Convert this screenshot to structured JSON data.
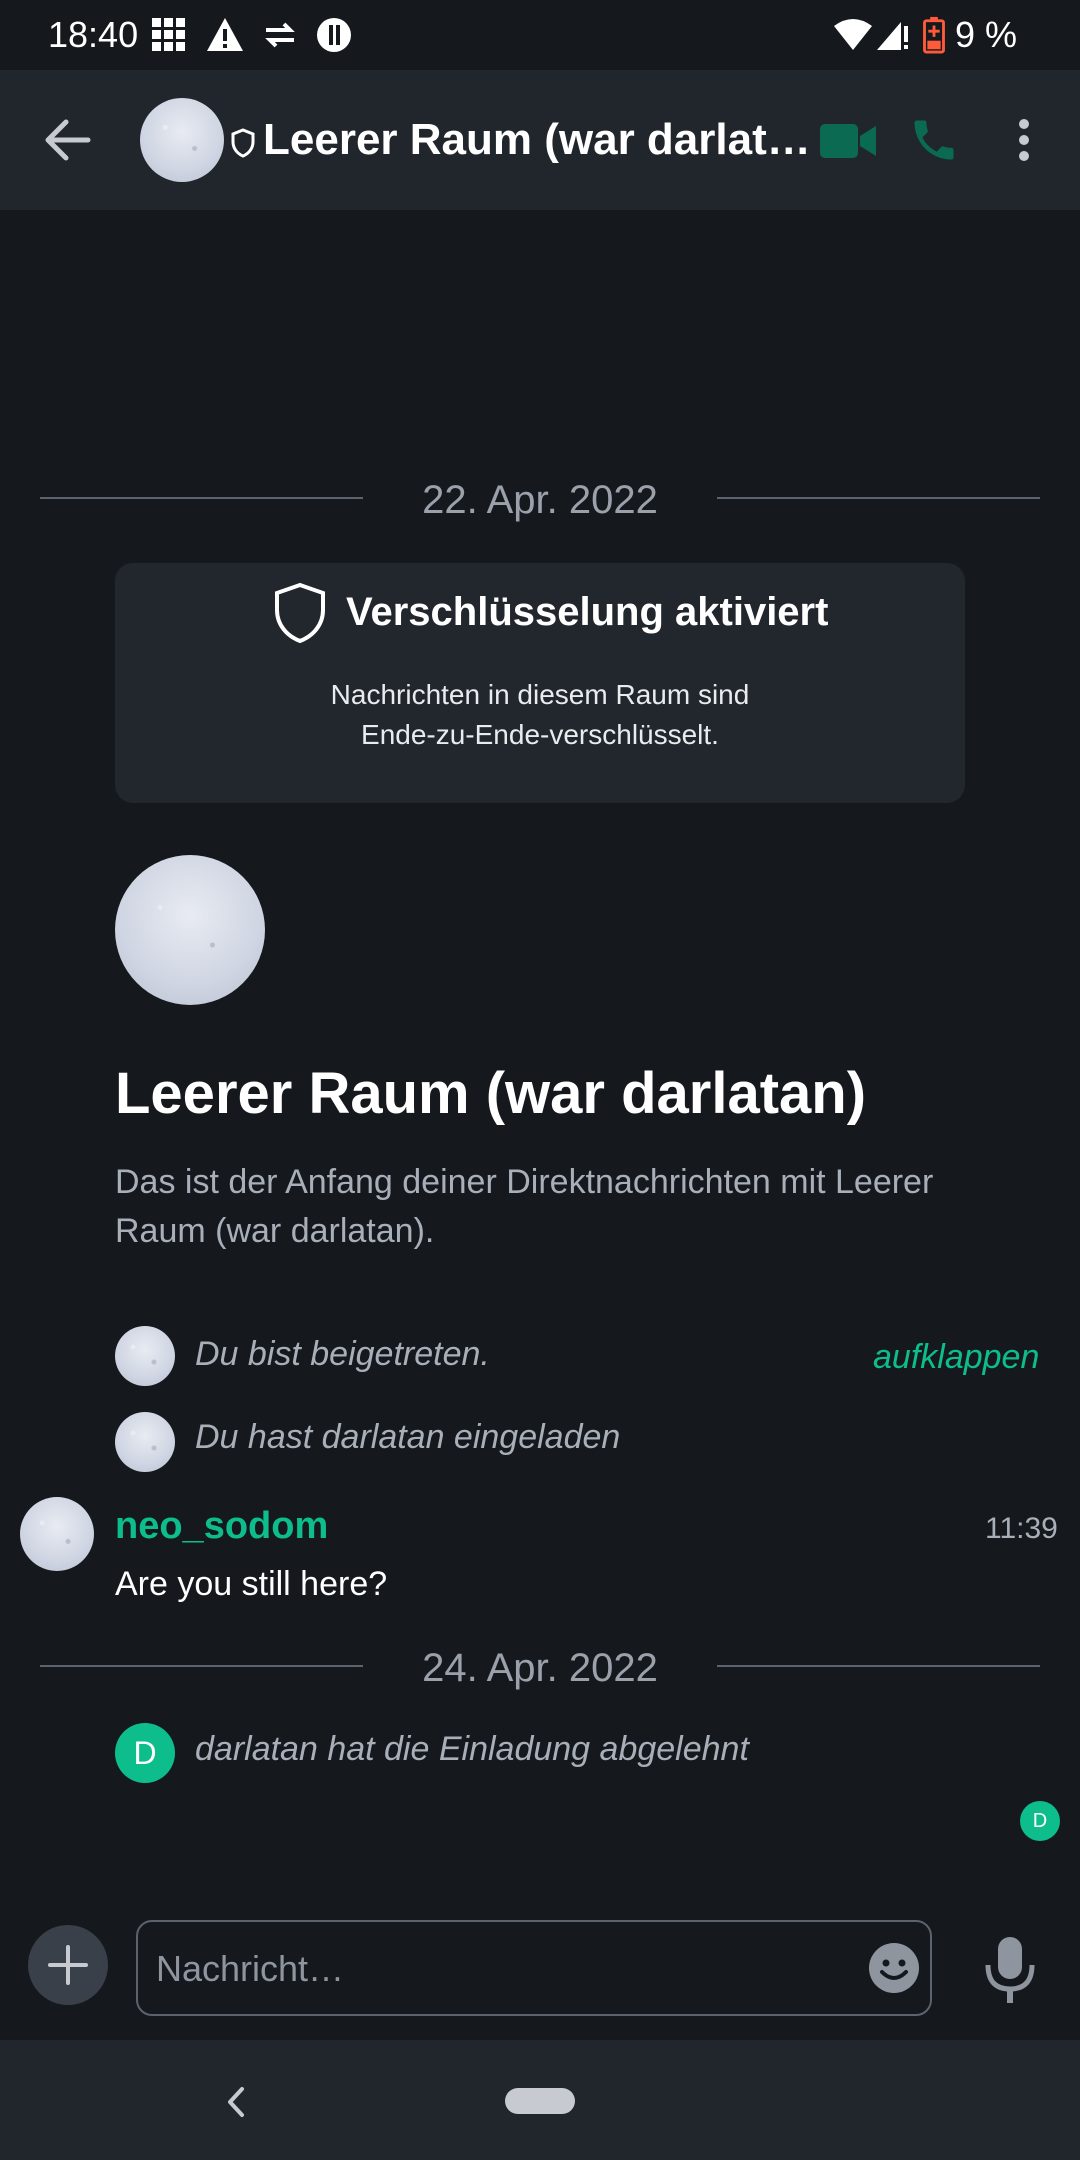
{
  "status_bar": {
    "time": "18:40",
    "battery_text": "9 %",
    "icons": [
      "grid-icon",
      "warning-icon",
      "data-sync-icon",
      "do-not-disturb-icon",
      "wifi-icon",
      "signal-icon",
      "battery-low-icon"
    ]
  },
  "app_bar": {
    "room_title": "Leerer Raum (war darlat…",
    "icons": [
      "back-arrow-icon",
      "shield-icon",
      "video-call-icon",
      "phone-call-icon",
      "more-vert-icon"
    ]
  },
  "timeline": {
    "date_1": "22. Apr. 2022",
    "encryption": {
      "title": "Verschlüsselung aktiviert",
      "line1": "Nachrichten in diesem Raum sind",
      "line2": "Ende-zu-Ende-verschlüsselt."
    },
    "room_heading": "Leerer Raum (war darlatan)",
    "intro_line1": "Das ist der Anfang deiner Direktnachrichten mit Leerer",
    "intro_line2": "Raum (war darlatan).",
    "events": [
      {
        "text": "Du bist beigetreten."
      },
      {
        "text": "Du hast darlatan eingeladen"
      }
    ],
    "expand_label": "aufklappen",
    "message": {
      "sender": "neo_sodom",
      "time": "11:39",
      "body": "Are you still here?"
    },
    "date_2": "24. Apr. 2022",
    "decline_event": {
      "avatar_letter": "D",
      "text": "darlatan hat die Einladung abgelehnt"
    },
    "read_receipt_letter": "D"
  },
  "composer": {
    "placeholder": "Nachricht…"
  },
  "colors": {
    "background": "#15191e",
    "accent": "#0dbd8b",
    "card": "#22272e",
    "muted_text": "#a8afb8"
  }
}
